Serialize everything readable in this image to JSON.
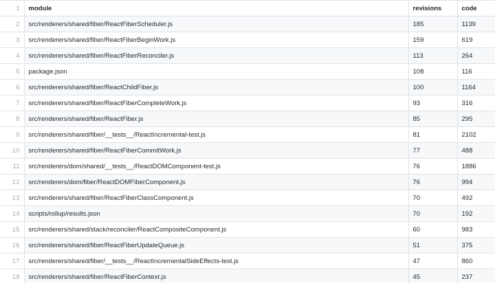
{
  "table": {
    "header": {
      "line": "1",
      "module": "module",
      "revisions": "revisions",
      "code": "code"
    },
    "rows": [
      {
        "line": "2",
        "module": "src/renderers/shared/fiber/ReactFiberScheduler.js",
        "revisions": "185",
        "code": "1139"
      },
      {
        "line": "3",
        "module": "src/renderers/shared/fiber/ReactFiberBeginWork.js",
        "revisions": "159",
        "code": "619"
      },
      {
        "line": "4",
        "module": "src/renderers/shared/fiber/ReactFiberReconciler.js",
        "revisions": "113",
        "code": "264"
      },
      {
        "line": "5",
        "module": "package.json",
        "revisions": "108",
        "code": "116"
      },
      {
        "line": "6",
        "module": "src/renderers/shared/fiber/ReactChildFiber.js",
        "revisions": "100",
        "code": "1164"
      },
      {
        "line": "7",
        "module": "src/renderers/shared/fiber/ReactFiberCompleteWork.js",
        "revisions": "93",
        "code": "316"
      },
      {
        "line": "8",
        "module": "src/renderers/shared/fiber/ReactFiber.js",
        "revisions": "85",
        "code": "295"
      },
      {
        "line": "9",
        "module": "src/renderers/shared/fiber/__tests__/ReactIncremental-test.js",
        "revisions": "81",
        "code": "2102"
      },
      {
        "line": "10",
        "module": "src/renderers/shared/fiber/ReactFiberCommitWork.js",
        "revisions": "77",
        "code": "488"
      },
      {
        "line": "11",
        "module": "src/renderers/dom/shared/__tests__/ReactDOMComponent-test.js",
        "revisions": "76",
        "code": "1886"
      },
      {
        "line": "12",
        "module": "src/renderers/dom/fiber/ReactDOMFiberComponent.js",
        "revisions": "76",
        "code": "994"
      },
      {
        "line": "13",
        "module": "src/renderers/shared/fiber/ReactFiberClassComponent.js",
        "revisions": "70",
        "code": "492"
      },
      {
        "line": "14",
        "module": "scripts/rollup/results.json",
        "revisions": "70",
        "code": "192"
      },
      {
        "line": "15",
        "module": "src/renderers/shared/stack/reconciler/ReactCompositeComponent.js",
        "revisions": "60",
        "code": "983"
      },
      {
        "line": "16",
        "module": "src/renderers/shared/fiber/ReactFiberUpdateQueue.js",
        "revisions": "51",
        "code": "375"
      },
      {
        "line": "17",
        "module": "src/renderers/shared/fiber/__tests__/ReactIncrementalSideEffects-test.js",
        "revisions": "47",
        "code": "860"
      },
      {
        "line": "18",
        "module": "src/renderers/shared/fiber/ReactFiberContext.js",
        "revisions": "45",
        "code": "237"
      }
    ]
  }
}
